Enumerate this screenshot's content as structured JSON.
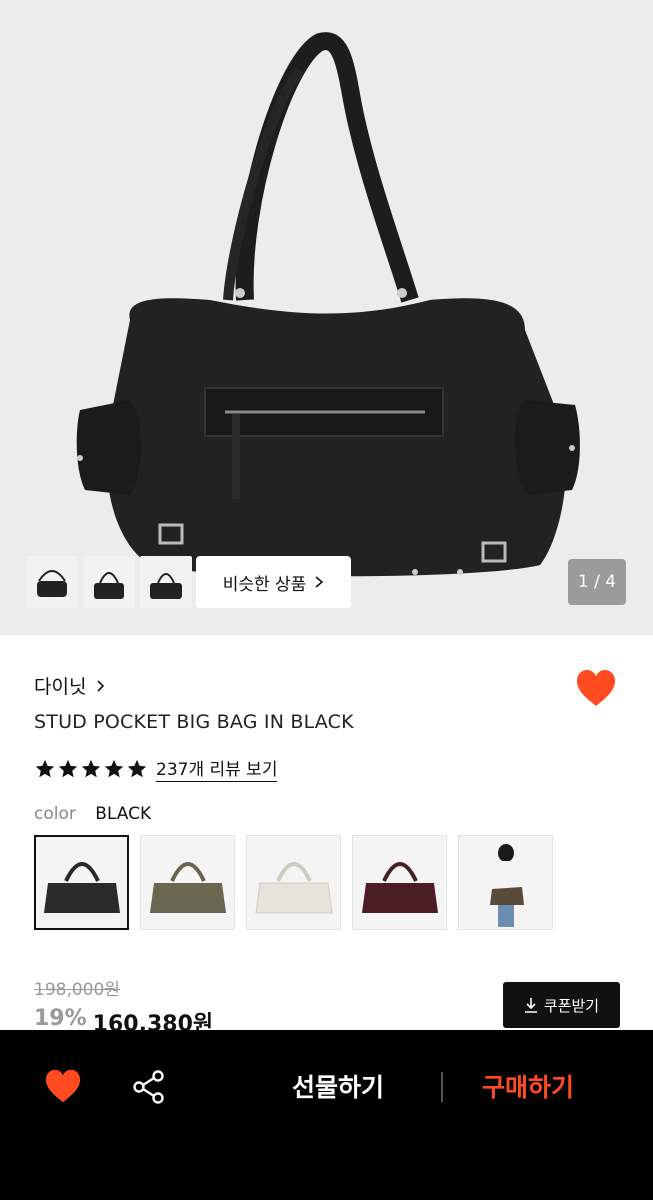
{
  "gallery": {
    "similar_label": "비슷한 상품",
    "page_counter": "1 / 4"
  },
  "product": {
    "brand": "다이닛",
    "title": "STUD POCKET BIG BAG IN BLACK",
    "rating_stars": 5,
    "review_link": "237개 리뷰 보기",
    "color_label": "color",
    "color_value": "BLACK",
    "swatches": [
      {
        "color": "#2a2a2a"
      },
      {
        "color": "#6a6650"
      },
      {
        "color": "#e8e6df"
      },
      {
        "color": "#4a1e22"
      },
      {
        "color": "#5a4a3a"
      }
    ],
    "original_price": "198,000원",
    "discount": "19%",
    "price": "160,380원",
    "coupon_label": "쿠폰받기"
  },
  "bottom_bar": {
    "gift_label": "선물하기",
    "buy_label": "구매하기"
  },
  "colors": {
    "accent": "#ff4b1f",
    "heart": "#ff4b1f"
  }
}
